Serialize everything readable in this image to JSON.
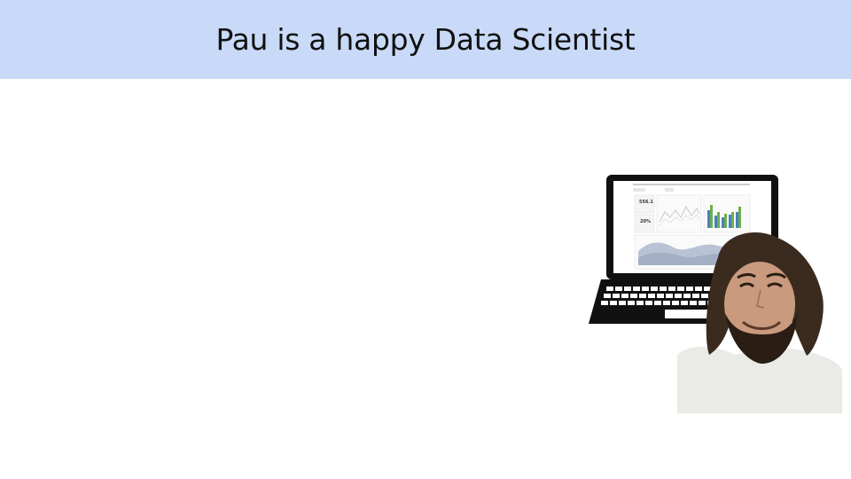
{
  "slide": {
    "title": "Pau is a happy Data Scientist",
    "title_bar_color": "#c9daf8"
  },
  "laptop_screen": {
    "kpi_1": "556.1",
    "kpi_2": "20%",
    "bar_colors": [
      "#4a7fc1",
      "#6ab04c"
    ]
  },
  "photo": {
    "icon": "person-photo"
  }
}
